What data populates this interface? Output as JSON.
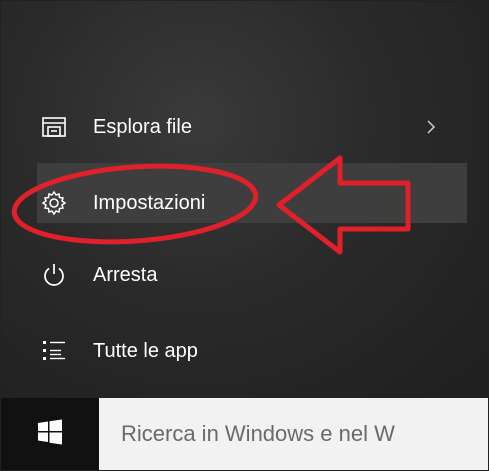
{
  "start_menu": {
    "items": [
      {
        "label": "Esplora file",
        "icon": "file-explorer-icon",
        "has_submenu": true
      },
      {
        "label": "Impostazioni",
        "icon": "settings-gear-icon",
        "has_submenu": false
      },
      {
        "label": "Arresta",
        "icon": "power-icon",
        "has_submenu": false
      },
      {
        "label": "Tutte le app",
        "icon": "all-apps-list-icon",
        "has_submenu": false
      }
    ]
  },
  "taskbar": {
    "start_icon": "windows-logo-icon",
    "search_text": "Ricerca in Windows e nel W"
  },
  "annotation": {
    "color": "#e0202a",
    "shapes": [
      "highlight-ellipse",
      "pointer-arrow"
    ]
  }
}
